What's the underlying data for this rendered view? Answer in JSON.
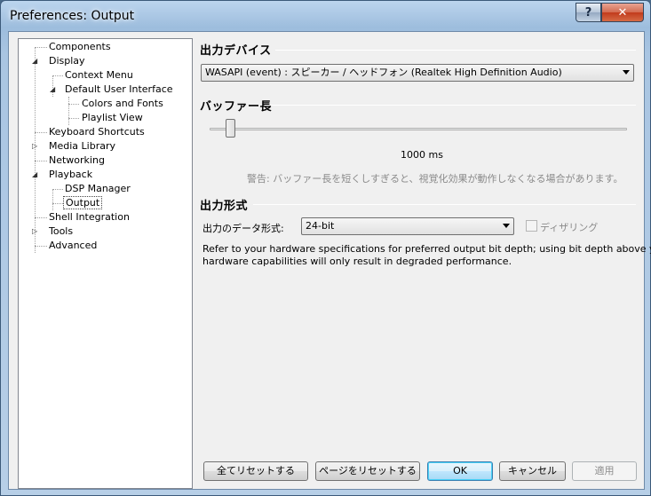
{
  "window": {
    "title": "Preferences: Output",
    "help_label": "?",
    "close_label": "✕"
  },
  "tree": {
    "items": [
      {
        "label": "Components"
      },
      {
        "label": "Display"
      },
      {
        "label": "Context Menu"
      },
      {
        "label": "Default User Interface"
      },
      {
        "label": "Colors and Fonts"
      },
      {
        "label": "Playlist View"
      },
      {
        "label": "Keyboard Shortcuts"
      },
      {
        "label": "Media Library"
      },
      {
        "label": "Networking"
      },
      {
        "label": "Playback"
      },
      {
        "label": "DSP Manager"
      },
      {
        "label": "Output"
      },
      {
        "label": "Shell Integration"
      },
      {
        "label": "Tools"
      },
      {
        "label": "Advanced"
      }
    ]
  },
  "output_device": {
    "header": "出力デバイス",
    "selected": "WASAPI (event) : スピーカー / ヘッドフォン (Realtek High Definition Audio)"
  },
  "buffer": {
    "header": "バッファー長",
    "value_label": "1000 ms",
    "level_fraction": 0.04,
    "warning": "警告: バッファー長を短くしすぎると、視覚化効果が動作しなくなる場合があります。"
  },
  "output_format": {
    "header": "出力形式",
    "bit_depth_label": "出力のデータ形式:",
    "bit_depth_selected": "24-bit",
    "dither_label": "ディザリング",
    "info_line1": "Refer to your hardware specifications for preferred output bit depth; using bit depth above your",
    "info_line2": "hardware capabilities will only result in degraded performance."
  },
  "buttons": {
    "reset_all": "全てリセットする",
    "reset_page": "ページをリセットする",
    "ok": "OK",
    "cancel": "キャンセル",
    "apply": "適用"
  }
}
